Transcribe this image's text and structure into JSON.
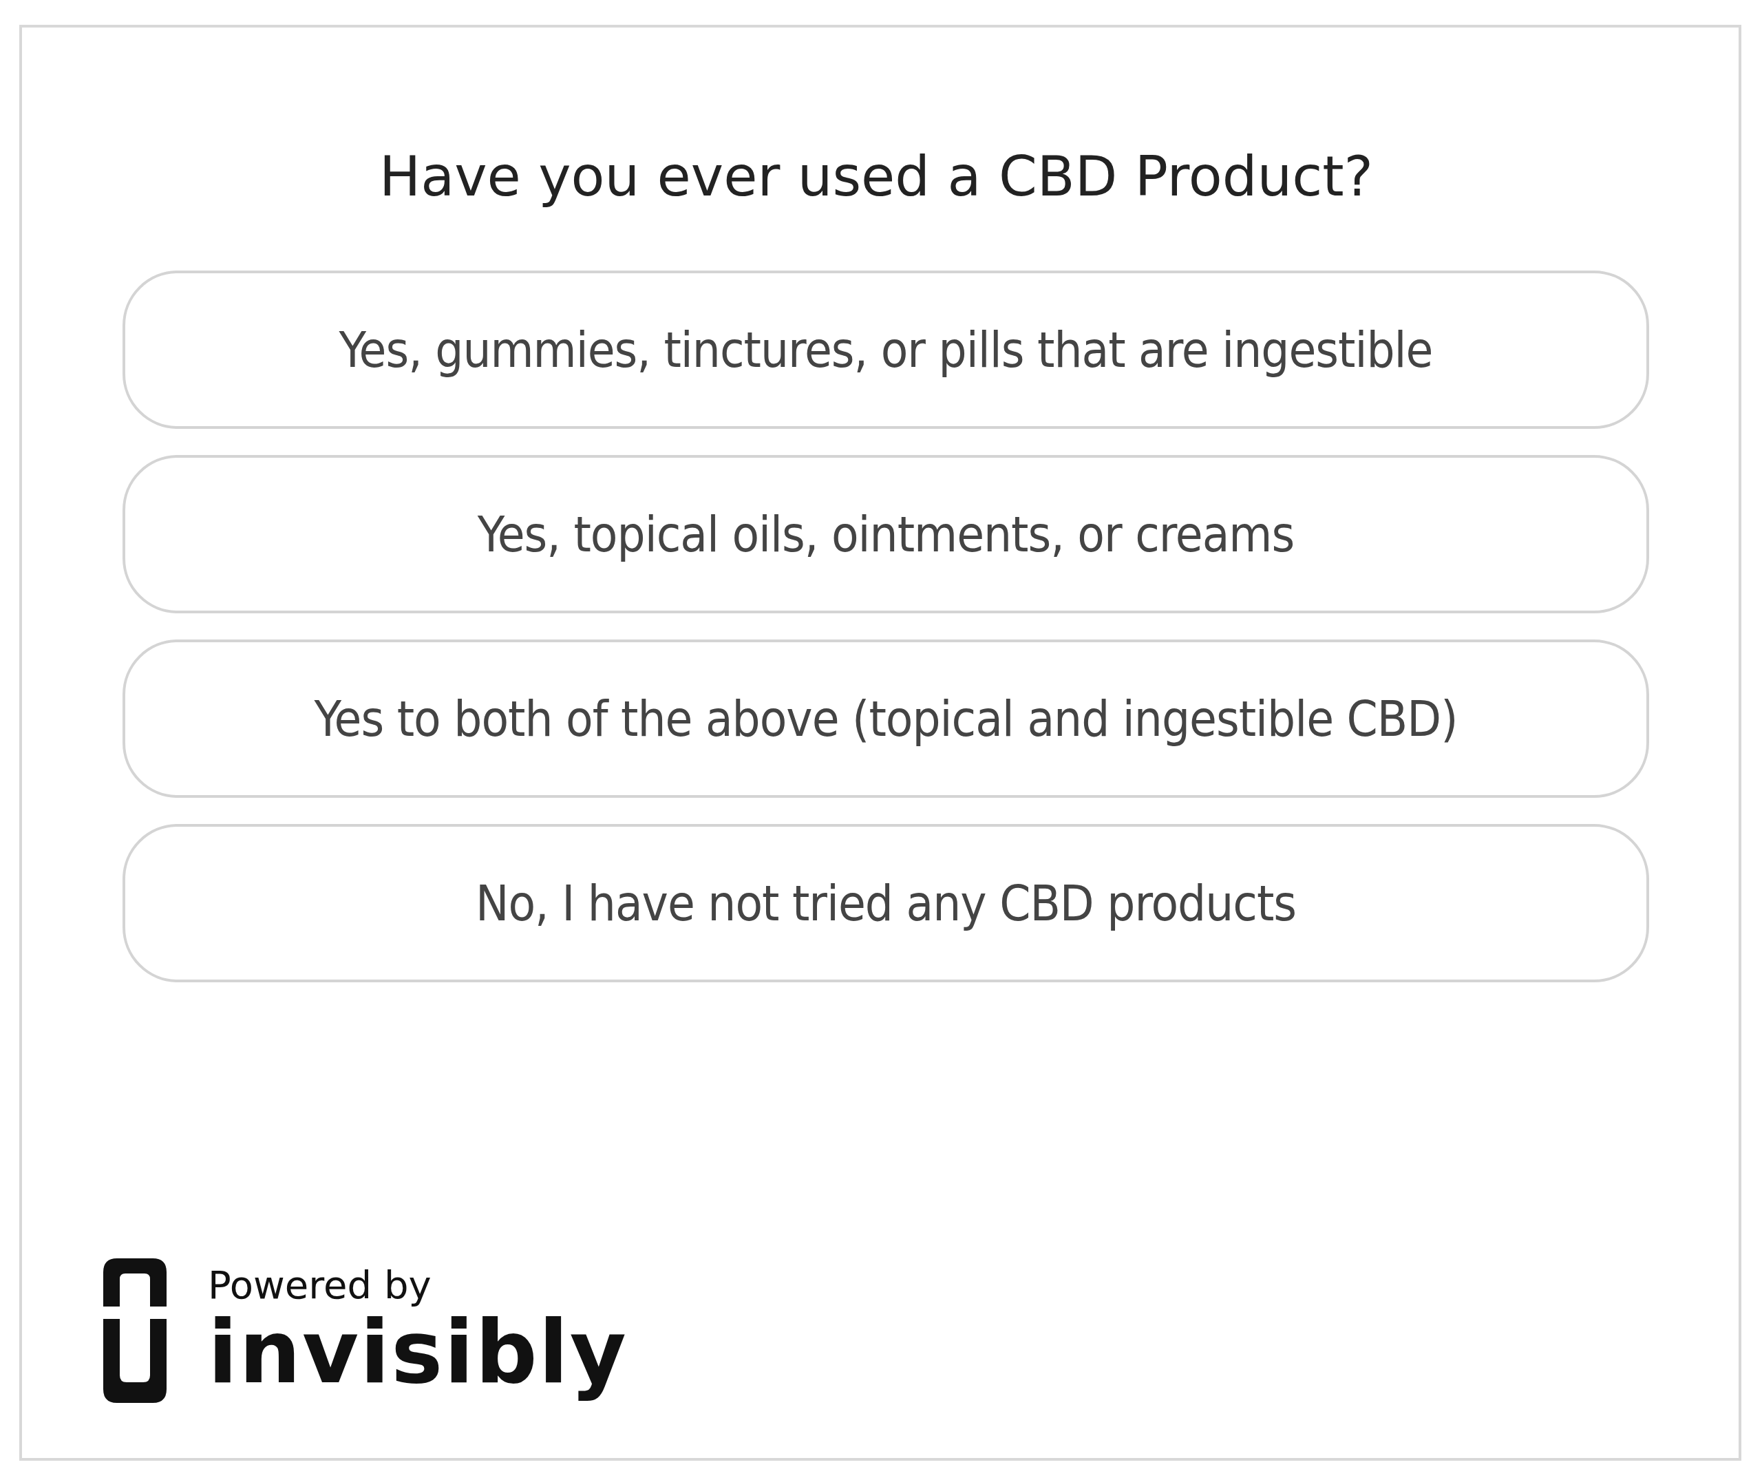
{
  "question": "Have you ever used a CBD Product?",
  "options": [
    {
      "label": "Yes, gummies, tinctures, or pills that are ingestible",
      "selected": false
    },
    {
      "label": "Yes, topical oils, ointments, or creams",
      "selected": false
    },
    {
      "label": "Yes to both of the above (topical and ingestible CBD)",
      "selected": false
    },
    {
      "label": "No, I have not tried any CBD products",
      "selected": false
    }
  ],
  "footer": {
    "powered_by": "Powered by",
    "brand": "invisibly"
  }
}
